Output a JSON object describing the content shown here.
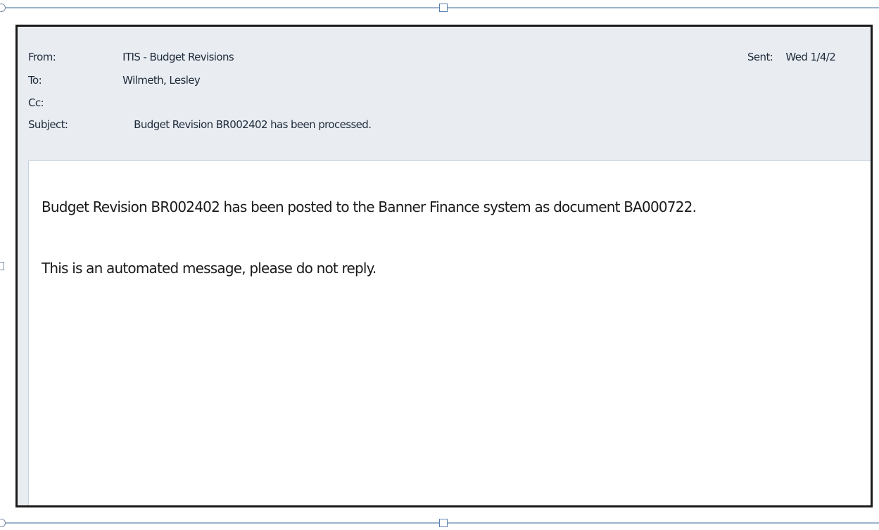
{
  "email": {
    "from_label": "From:",
    "from_value": "ITIS - Budget Revisions",
    "to_label": "To:",
    "to_value": "Wilmeth, Lesley",
    "cc_label": "Cc:",
    "cc_value": "",
    "subject_label": "Subject:",
    "subject_value": "Budget Revision BR002402 has been processed.",
    "sent_label": "Sent:",
    "sent_value": "Wed 1/4/2",
    "body_line_1": "Budget Revision BR002402 has been posted to the Banner Finance system as document BA000722.",
    "body_line_2": "This is an automated message, please do not reply."
  },
  "colors": {
    "header_bg": "#e9edf2",
    "frame_line": "#9bb3cf",
    "window_border": "#1a1a1a"
  }
}
